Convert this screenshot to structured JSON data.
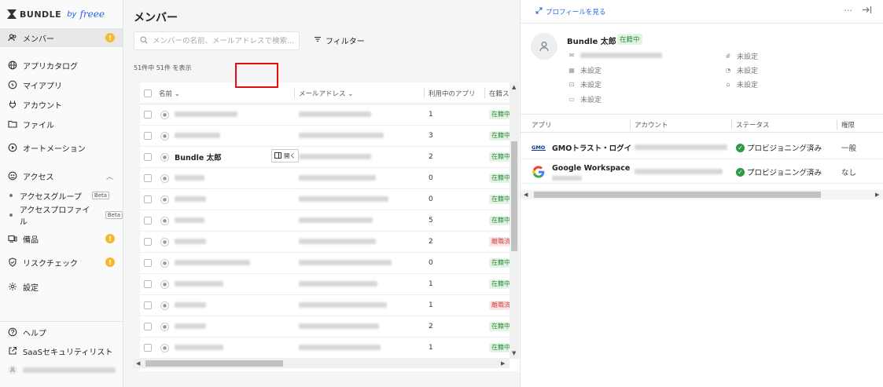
{
  "sidebar": {
    "brand": {
      "name": "BUNDLE",
      "by": "by",
      "partner": "freee"
    },
    "items": [
      {
        "label": "メンバー",
        "icon": "members-icon",
        "active": true,
        "badge": "!"
      },
      {
        "label": "アプリカタログ",
        "icon": "globe-icon"
      },
      {
        "label": "マイアプリ",
        "icon": "lightning-icon"
      },
      {
        "label": "アカウント",
        "icon": "key-icon"
      },
      {
        "label": "ファイル",
        "icon": "folder-icon"
      },
      {
        "label": "オートメーション",
        "icon": "play-icon"
      },
      {
        "label": "アクセス",
        "icon": "access-icon",
        "expanded": true
      },
      {
        "label": "備品",
        "icon": "device-icon",
        "badge": "!"
      },
      {
        "label": "リスクチェック",
        "icon": "shield-icon",
        "badge": "!"
      },
      {
        "label": "設定",
        "icon": "gear-icon"
      }
    ],
    "sub_items": [
      {
        "label": "アクセスグループ",
        "badge": "Beta"
      },
      {
        "label": "アクセスプロファイル",
        "badge": "Beta"
      }
    ],
    "footer": [
      {
        "label": "ヘルプ",
        "icon": "help-icon"
      },
      {
        "label": "SaaSセキュリティリスト",
        "icon": "external-link-icon"
      }
    ]
  },
  "main": {
    "title": "メンバー",
    "search_placeholder": "メンバーの名前、メールアドレスで検索...",
    "filter_label": "フィルター",
    "count_text": "51件中 51件 を表示",
    "columns": {
      "name": "名前",
      "email": "メールアドレス",
      "apps": "利用中のアプリ",
      "status": "在籍ス"
    },
    "rows": [
      {
        "name": "",
        "apps": "1",
        "status": "在籍中",
        "status_type": "green"
      },
      {
        "name": "",
        "apps": "3",
        "status": "在籍中",
        "status_type": "green"
      },
      {
        "name": "Bundle 太郎",
        "apps": "2",
        "status": "在籍中",
        "status_type": "green",
        "hover": true
      },
      {
        "name": "",
        "apps": "0",
        "status": "在籍中",
        "status_type": "green"
      },
      {
        "name": "",
        "apps": "0",
        "status": "在籍中",
        "status_type": "green"
      },
      {
        "name": "",
        "apps": "5",
        "status": "在籍中",
        "status_type": "green"
      },
      {
        "name": "",
        "apps": "2",
        "status": "離職済",
        "status_type": "red"
      },
      {
        "name": "",
        "apps": "0",
        "status": "在籍中",
        "status_type": "green"
      },
      {
        "name": "",
        "apps": "1",
        "status": "在籍中",
        "status_type": "green"
      },
      {
        "name": "",
        "apps": "1",
        "status": "離職済",
        "status_type": "red"
      },
      {
        "name": "",
        "apps": "2",
        "status": "在籍中",
        "status_type": "green"
      },
      {
        "name": "",
        "apps": "1",
        "status": "在籍中",
        "status_type": "green"
      }
    ],
    "open_button_label": "開く"
  },
  "panel": {
    "view_profile": "プロフィールを見る",
    "name": "Bundle 太郎",
    "status": "在籍中",
    "fields_left": [
      "未設定",
      "未設定",
      "未設定"
    ],
    "fields_left_last": "未設定",
    "fields_right": [
      "未設定",
      "未設定",
      "未設定"
    ],
    "app_columns": {
      "app": "アプリ",
      "account": "アカウント",
      "status": "ステータス",
      "permission": "権限"
    },
    "apps": [
      {
        "name": "GMOトラスト・ログイン",
        "status": "プロビジョニング済み",
        "permission": "一般",
        "logo": "gmo-logo"
      },
      {
        "name": "Google Workspace",
        "status": "プロビジョニング済み",
        "permission": "なし",
        "logo": "google-logo"
      }
    ]
  }
}
